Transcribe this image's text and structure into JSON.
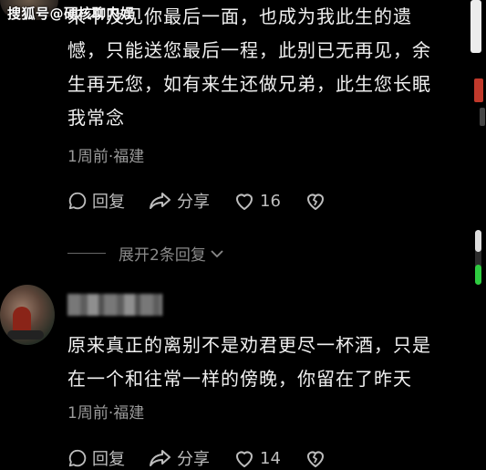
{
  "watermark": "搜狐号@硬核聊内娱",
  "comments": [
    {
      "lines": [
        "来不及见你最后一面，也成为我此生的遗",
        "憾，只能送您最后一程，此别已无再见，余",
        "生再无您，如有来生还做兄弟，此生您长眠",
        "我常念"
      ],
      "meta": "1周前·福建",
      "reply_label": "回复",
      "share_label": "分享",
      "likes": "16",
      "expand_label": "展开2条回复"
    },
    {
      "lines": [
        "原来真正的离别不是劝君更尽一杯酒，只是",
        "在一个和往常一样的傍晚，你留在了昨天"
      ],
      "meta": "1周前·福建",
      "reply_label": "回复",
      "share_label": "分享",
      "likes": "14"
    }
  ],
  "icons": {
    "reply": "comment-bubble-icon",
    "share": "share-arrow-icon",
    "like": "heart-icon",
    "dislike": "broken-heart-icon",
    "expand": "chevron-down-icon"
  },
  "colors": {
    "background": "#000000",
    "text": "#f0f0f0",
    "meta": "#9a9a9a",
    "scroll_accent": "#2ecc40"
  }
}
